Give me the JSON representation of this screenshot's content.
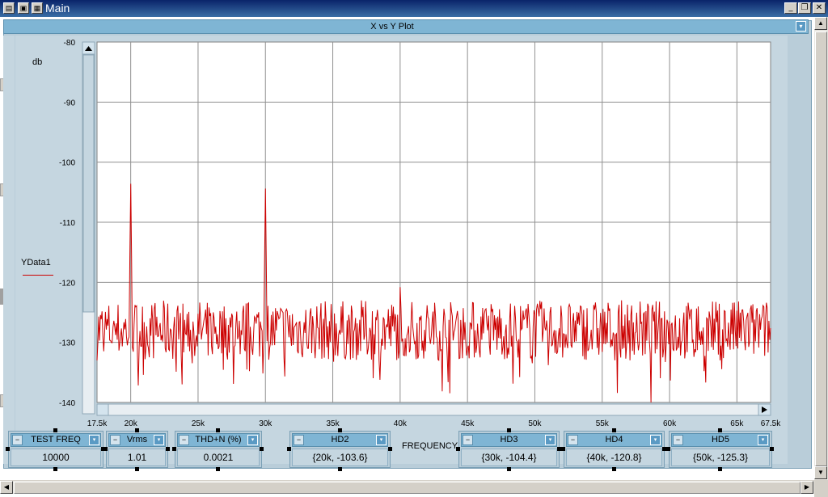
{
  "window": {
    "title": "Main"
  },
  "plot": {
    "title": "X vs Y Plot",
    "ylabel": "db",
    "xlabel": "FREQUENCY",
    "legend": "YData1"
  },
  "chart_data": {
    "type": "line",
    "title": "X vs Y Plot",
    "xlabel": "FREQUENCY",
    "ylabel": "db",
    "xlim": [
      17500,
      67500
    ],
    "ylim": [
      -140,
      -80
    ],
    "x_ticks": [
      "17.5k",
      "20k",
      "25k",
      "30k",
      "35k",
      "40k",
      "45k",
      "50k",
      "55k",
      "60k",
      "65k",
      "67.5k"
    ],
    "x_tick_values": [
      17500,
      20000,
      25000,
      30000,
      35000,
      40000,
      45000,
      50000,
      55000,
      60000,
      65000,
      67500
    ],
    "y_ticks": [
      "-80",
      "-90",
      "-100",
      "-110",
      "-120",
      "-130",
      "-140"
    ],
    "y_tick_values": [
      -80,
      -90,
      -100,
      -110,
      -120,
      -130,
      -140
    ],
    "grid": true,
    "color": "#cc0000",
    "series": [
      {
        "name": "YData1",
        "peaks": [
          {
            "x": 20000,
            "y": -103.6
          },
          {
            "x": 30000,
            "y": -104.4
          },
          {
            "x": 40000,
            "y": -120.8
          },
          {
            "x": 50000,
            "y": -125.3
          }
        ],
        "noise_floor": -128
      }
    ]
  },
  "controls": [
    {
      "title": "TEST FREQ",
      "value": "10000"
    },
    {
      "title": "Vrms",
      "value": "1.01"
    },
    {
      "title": "THD+N (%)",
      "value": "0.0021"
    },
    {
      "title": "HD2",
      "value": "{20k, -103.6}"
    },
    {
      "title": "HD3",
      "value": "{30k, -104.4}"
    },
    {
      "title": "HD4",
      "value": "{40k, -120.8}"
    },
    {
      "title": "HD5",
      "value": "{50k, -125.3}"
    }
  ]
}
